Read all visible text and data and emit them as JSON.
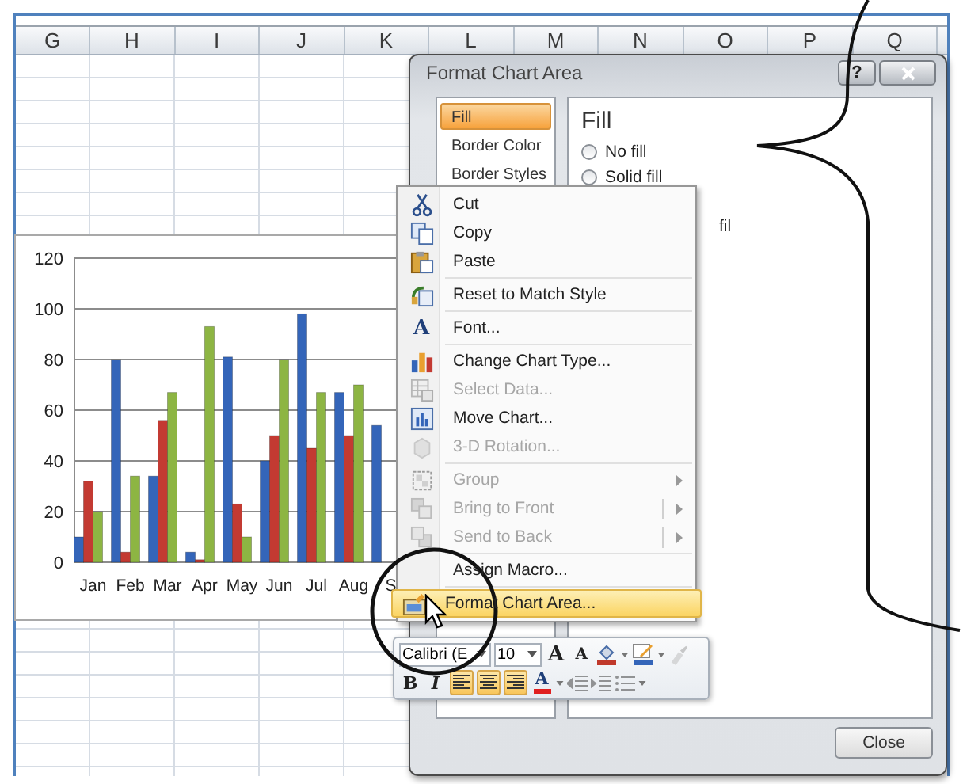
{
  "spreadsheet": {
    "columns": [
      "G",
      "H",
      "I",
      "J",
      "K",
      "L",
      "M",
      "N",
      "O",
      "P",
      "Q"
    ]
  },
  "chart": {
    "chart_data": {
      "type": "bar",
      "grid": true,
      "categories": [
        "Jan",
        "Feb",
        "Mar",
        "Apr",
        "May",
        "Jun",
        "Jul",
        "Aug",
        "S"
      ],
      "ylim": [
        0,
        120
      ],
      "yticks": [
        0,
        20,
        40,
        60,
        80,
        100,
        120
      ],
      "series": [
        {
          "color": "#3465b9",
          "values": [
            10,
            80,
            34,
            4,
            81,
            40,
            98,
            67,
            54
          ]
        },
        {
          "color": "#c33a32",
          "values": [
            32,
            4,
            56,
            1,
            23,
            50,
            45,
            50,
            null
          ]
        },
        {
          "color": "#8db543",
          "values": [
            20,
            34,
            67,
            93,
            10,
            80,
            67,
            70,
            null
          ]
        }
      ]
    }
  },
  "dialog": {
    "title": "Format Chart Area",
    "help_button": "?",
    "nav_items": [
      {
        "label": "Fill",
        "selected": true
      },
      {
        "label": "Border Color",
        "selected": false
      },
      {
        "label": "Border Styles",
        "selected": false
      }
    ],
    "section_title": "Fill",
    "options": [
      {
        "kind": "radio",
        "label": "No fill",
        "selected": false
      },
      {
        "kind": "radio",
        "label": "Solid fill",
        "selected": false
      },
      {
        "kind": "partial",
        "label": "fil"
      }
    ],
    "close_button": "Close"
  },
  "context_menu": {
    "items": [
      {
        "kind": "item",
        "label": "Cut",
        "disabled": false,
        "highlighted": false,
        "submenu": false
      },
      {
        "kind": "item",
        "label": "Copy",
        "disabled": false,
        "highlighted": false,
        "submenu": false
      },
      {
        "kind": "item",
        "label": "Paste",
        "disabled": false,
        "highlighted": false,
        "submenu": false
      },
      {
        "kind": "separator"
      },
      {
        "kind": "item",
        "label": "Reset to Match Style",
        "disabled": false,
        "highlighted": false,
        "submenu": false
      },
      {
        "kind": "separator"
      },
      {
        "kind": "item",
        "label": "Font...",
        "icon_text": "A",
        "disabled": false,
        "highlighted": false,
        "submenu": false
      },
      {
        "kind": "separator"
      },
      {
        "kind": "item",
        "label": "Change Chart Type...",
        "disabled": false,
        "highlighted": false,
        "submenu": false
      },
      {
        "kind": "item",
        "label": "Select Data...",
        "disabled": true,
        "highlighted": false,
        "submenu": false
      },
      {
        "kind": "item",
        "label": "Move Chart...",
        "disabled": false,
        "highlighted": false,
        "submenu": false
      },
      {
        "kind": "item",
        "label": "3-D Rotation...",
        "disabled": true,
        "highlighted": false,
        "submenu": false
      },
      {
        "kind": "separator"
      },
      {
        "kind": "item",
        "label": "Group",
        "disabled": true,
        "highlighted": false,
        "submenu": true
      },
      {
        "kind": "item",
        "label": "Bring to Front",
        "disabled": true,
        "highlighted": false,
        "submenu": true
      },
      {
        "kind": "item",
        "label": "Send to Back",
        "disabled": true,
        "highlighted": false,
        "submenu": true
      },
      {
        "kind": "separator"
      },
      {
        "kind": "item",
        "label": "Assign Macro...",
        "disabled": false,
        "highlighted": false,
        "submenu": false
      },
      {
        "kind": "separator"
      },
      {
        "kind": "item",
        "label": "Format Chart Area...",
        "disabled": false,
        "highlighted": true,
        "submenu": false
      }
    ]
  },
  "mini_toolbar": {
    "font_name": "Calibri (E",
    "font_size": "10",
    "grow_font": "A",
    "shrink_font": "A",
    "bold": "B",
    "italic": "I",
    "font_color": "A",
    "align_buttons": [
      {
        "selected": true
      },
      {
        "selected": true
      },
      {
        "selected": true
      }
    ]
  }
}
